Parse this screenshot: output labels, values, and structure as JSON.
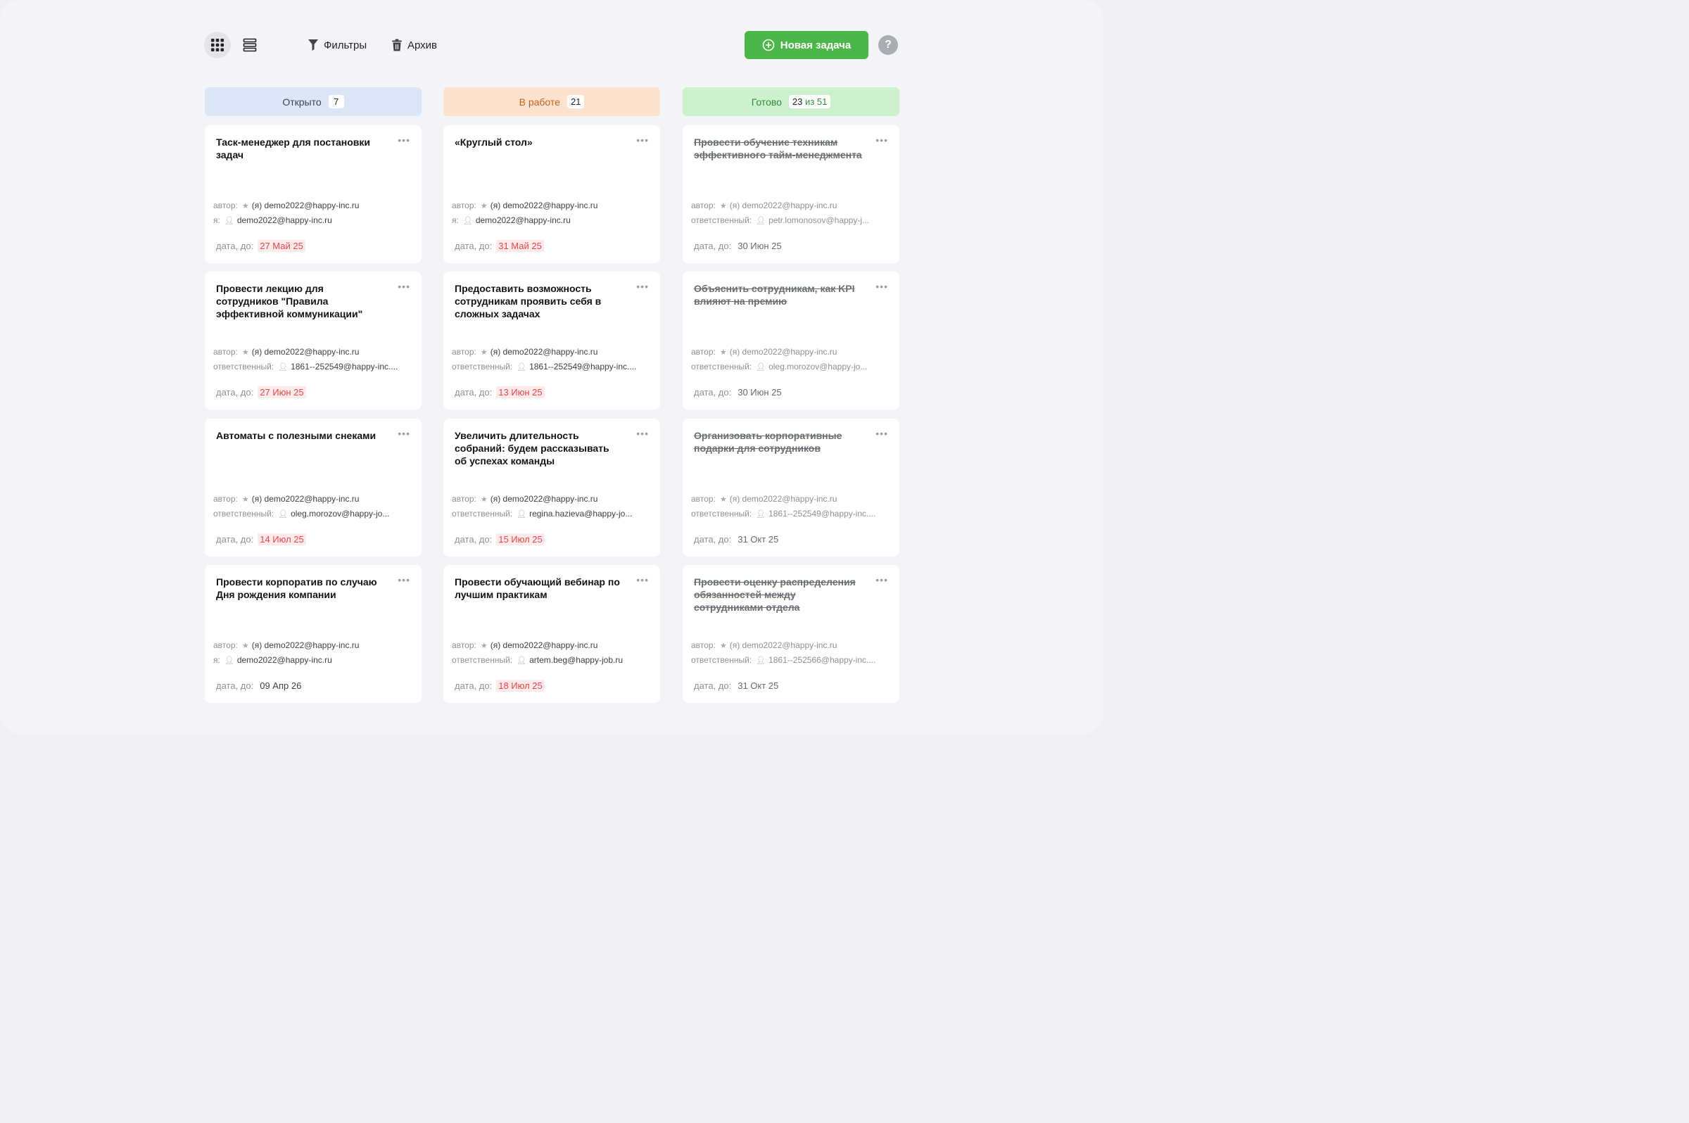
{
  "toolbar": {
    "grid_view_icon": "grid-icon",
    "list_view_icon": "list-icon",
    "filters_label": "Фильтры",
    "archive_label": "Архив",
    "new_task_label": "Новая задача",
    "help_label": "?"
  },
  "colors": {
    "accent_green": "#4cb648",
    "overdue_red": "#e5474b",
    "open_header": "#dbe7f7",
    "in_progress_header": "#fde2cf",
    "done_header": "#cdf1cf"
  },
  "columns": [
    {
      "title": "Открыто",
      "count": "7",
      "cards": [
        {
          "title": "Таск-менеджер для постановки задач",
          "author_label": "автор:",
          "author": "(я) demo2022@happy-inc.ru",
          "resp_label": "я:",
          "resp": "demo2022@happy-inc.ru",
          "due_label": "дата, до:",
          "due": "27 Май 25",
          "overdue": true
        },
        {
          "title": "Провести лекцию для сотрудников \"Правила эффективной коммуникации\"",
          "author_label": "автор:",
          "author": "(я) demo2022@happy-inc.ru",
          "resp_label": "ответственный:",
          "resp": "1861--252549@happy-inc....",
          "due_label": "дата, до:",
          "due": "27 Июн 25",
          "overdue": true
        },
        {
          "title": "Автоматы с полезными снеками",
          "author_label": "автор:",
          "author": "(я) demo2022@happy-inc.ru",
          "resp_label": "ответственный:",
          "resp": "oleg.morozov@happy-jo...",
          "due_label": "дата, до:",
          "due": "14 Июл 25",
          "overdue": true
        },
        {
          "title": "Провести корпоратив по случаю Дня рождения компании",
          "author_label": "автор:",
          "author": "(я) demo2022@happy-inc.ru",
          "resp_label": "я:",
          "resp": "demo2022@happy-inc.ru",
          "due_label": "дата, до:",
          "due": "09 Апр 26",
          "overdue": false
        }
      ]
    },
    {
      "title": "В работе",
      "count": "21",
      "cards": [
        {
          "title": "«Круглый стол»",
          "author_label": "автор:",
          "author": "(я) demo2022@happy-inc.ru",
          "resp_label": "я:",
          "resp": "demo2022@happy-inc.ru",
          "due_label": "дата, до:",
          "due": "31 Май 25",
          "overdue": true
        },
        {
          "title": "Предоставить возможность сотрудникам проявить себя в сложных задачах",
          "author_label": "автор:",
          "author": "(я) demo2022@happy-inc.ru",
          "resp_label": "ответственный:",
          "resp": "1861--252549@happy-inc....",
          "due_label": "дата, до:",
          "due": "13 Июн 25",
          "overdue": true
        },
        {
          "title": "Увеличить длительность собраний: будем рассказывать об успехах команды",
          "author_label": "автор:",
          "author": "(я) demo2022@happy-inc.ru",
          "resp_label": "ответственный:",
          "resp": "regina.hazieva@happy-jo...",
          "due_label": "дата, до:",
          "due": "15 Июл 25",
          "overdue": true
        },
        {
          "title": "Провести обучающий вебинар по лучшим практикам",
          "author_label": "автор:",
          "author": "(я) demo2022@happy-inc.ru",
          "resp_label": "ответственный:",
          "resp": "artem.beg@happy-job.ru",
          "due_label": "дата, до:",
          "due": "18 Июл 25",
          "overdue": true
        }
      ]
    },
    {
      "title": "Готово",
      "count": "23",
      "count_sub": "из 51",
      "cards": [
        {
          "title": "Провести обучение техникам эффективного тайм-менеджмента",
          "author_label": "автор:",
          "author": "(я) demo2022@happy-inc.ru",
          "resp_label": "ответственный:",
          "resp": "petr.lomonosov@happy-j...",
          "due_label": "дата, до:",
          "due": "30 Июн 25",
          "overdue": false
        },
        {
          "title": "Объяснить сотрудникам, как KPI влияют на премию",
          "author_label": "автор:",
          "author": "(я) demo2022@happy-inc.ru",
          "resp_label": "ответственный:",
          "resp": "oleg.morozov@happy-jo...",
          "due_label": "дата, до:",
          "due": "30 Июн 25",
          "overdue": false
        },
        {
          "title": "Организовать корпоративные подарки для сотрудников",
          "author_label": "автор:",
          "author": "(я) demo2022@happy-inc.ru",
          "resp_label": "ответственный:",
          "resp": "1861--252549@happy-inc....",
          "due_label": "дата, до:",
          "due": "31 Окт 25",
          "overdue": false
        },
        {
          "title": "Провести оценку распределения обязанностей между сотрудниками отдела",
          "author_label": "автор:",
          "author": "(я) demo2022@happy-inc.ru",
          "resp_label": "ответственный:",
          "resp": "1861--252566@happy-inc....",
          "due_label": "дата, до:",
          "due": "31 Окт 25",
          "overdue": false
        }
      ]
    }
  ]
}
